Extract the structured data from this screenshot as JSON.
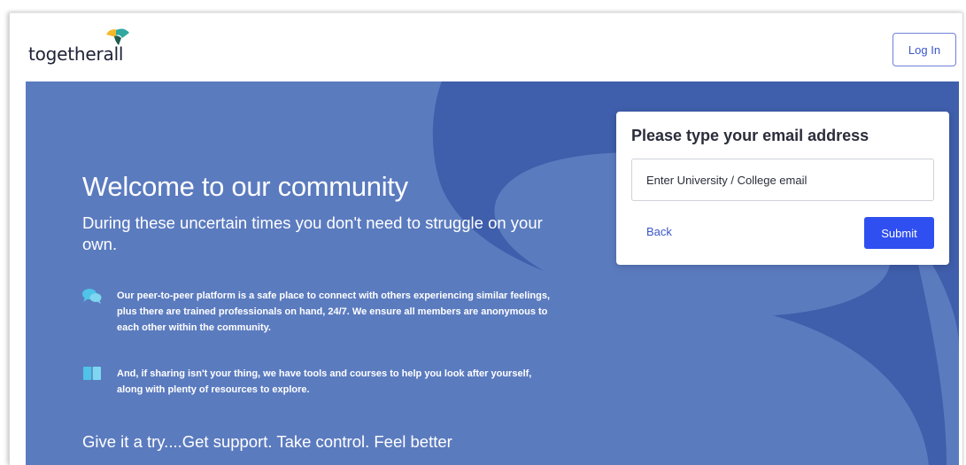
{
  "brand": {
    "logo_text": "togetherall",
    "logo_colors": [
      "#f3b82a",
      "#2fa8a0"
    ]
  },
  "header": {
    "login_label": "Log In"
  },
  "hero": {
    "title": "Welcome to our community",
    "subtitle": "During these uncertain times you don't need to struggle on your own.",
    "features": [
      {
        "icon": "chat-bubbles-icon",
        "text": "Our peer-to-peer platform is a safe place to connect with others experiencing similar feelings, plus there are trained professionals on hand, 24/7. We ensure all members are anonymous to each other within the community."
      },
      {
        "icon": "book-icon",
        "text": "And, if sharing isn't your thing, we have tools and courses to help you look after yourself, along with plenty of resources to explore."
      }
    ],
    "tagline": "Give it a try....Get support. Take control. Feel better"
  },
  "email_form": {
    "title": "Please type your email address",
    "email_value": "",
    "email_placeholder": "Enter University / College email",
    "back_label": "Back",
    "submit_label": "Submit"
  },
  "colors": {
    "hero_background": "#5b7bbf",
    "accent_blue": "#2f4ff0",
    "link_blue": "#3b56c8",
    "feature_icon": "#4fc3e8"
  }
}
